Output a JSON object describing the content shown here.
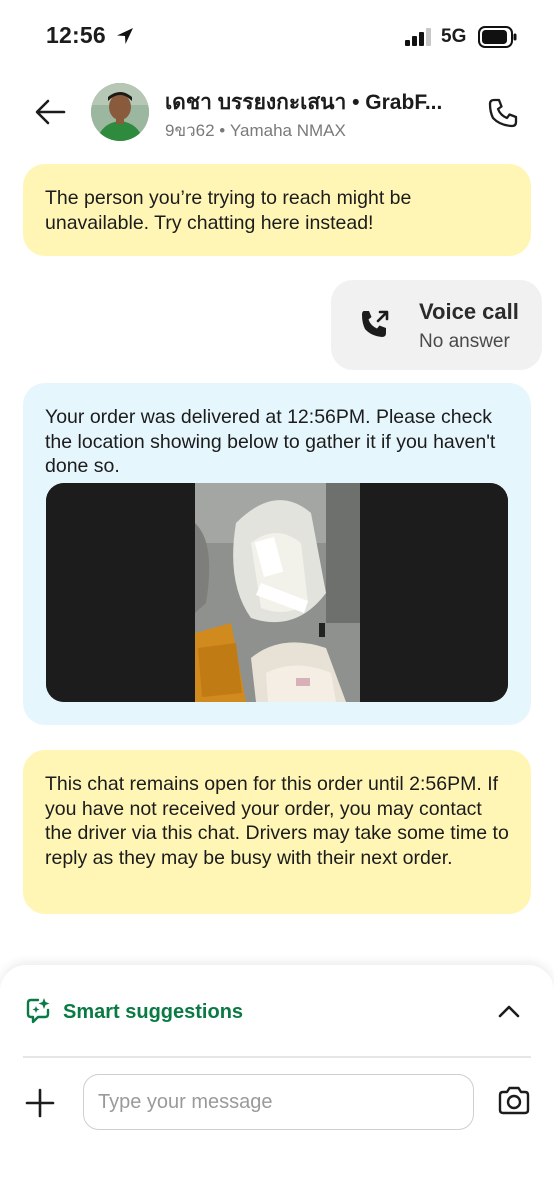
{
  "status_bar": {
    "time": "12:56",
    "network": "5G",
    "icons": [
      "location-arrow-icon",
      "signal-bars-icon",
      "battery-icon"
    ]
  },
  "header": {
    "driver_name": "เดชา บรรยงกะเสนา • GrabF...",
    "vehicle_info": "9ขว62 • Yamaha NMAX",
    "icons": [
      "back-arrow-icon",
      "phone-icon"
    ]
  },
  "messages": {
    "unavailable_notice": "The person you’re trying to reach might be unavailable. Try chatting here instead!",
    "voice_call": {
      "title": "Voice call",
      "status": "No answer",
      "icon": "outgoing-call-icon"
    },
    "delivered_notice": "Your order was delivered at 12:56PM. Please check the location showing below to gather it if you haven't done so.",
    "chat_open_notice": "This chat remains open for this order until 2:56PM. If you have not received your order, you may contact the driver via this chat. Drivers may take some time to reply as they may be busy with their next order."
  },
  "composer": {
    "smart_suggestions_label": "Smart suggestions",
    "input_placeholder": "Type your message",
    "input_value": "",
    "icons": [
      "smart-suggestions-icon",
      "chevron-up-icon",
      "plus-icon",
      "camera-icon"
    ]
  },
  "colors": {
    "notice_yellow": "#fff6b6",
    "notice_blue": "#e6f6fd",
    "call_gray": "#f1f1f1",
    "brand_green": "#0a7a45"
  }
}
